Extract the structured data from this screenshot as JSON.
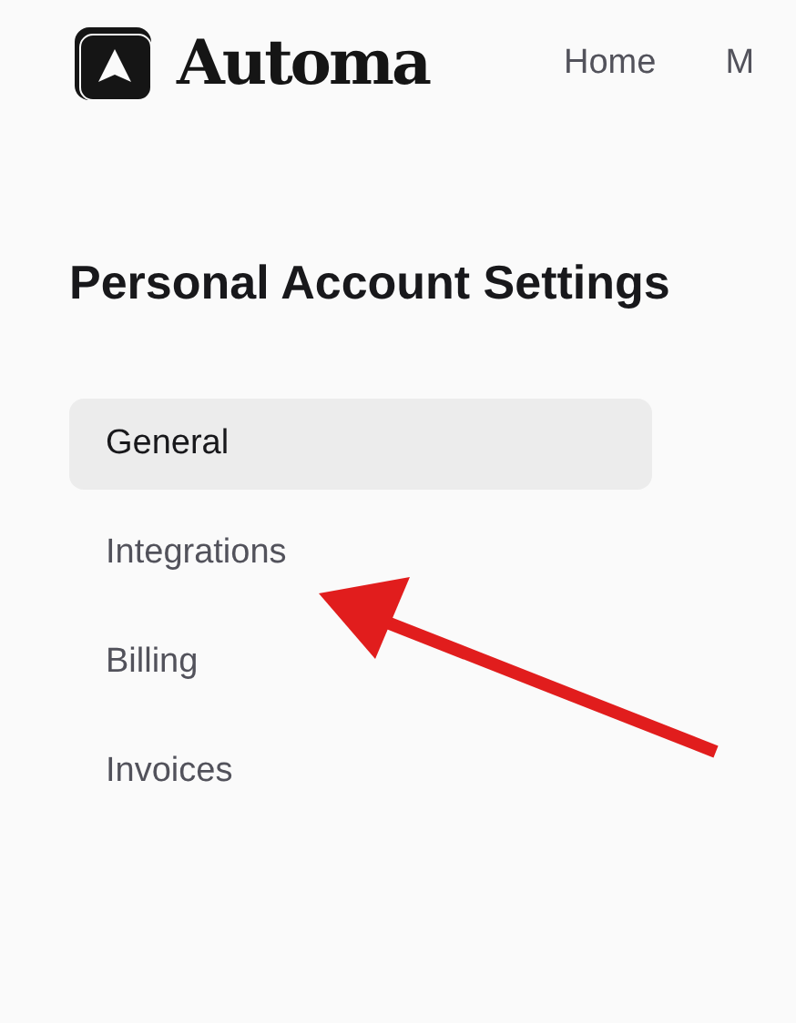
{
  "header": {
    "brand": "Automa",
    "nav": [
      "Home",
      "M"
    ]
  },
  "title": "Personal Account Settings",
  "sidebar": {
    "items": [
      {
        "label": "General",
        "selected": true
      },
      {
        "label": "Integrations",
        "selected": false
      },
      {
        "label": "Billing",
        "selected": false
      },
      {
        "label": "Invoices",
        "selected": false
      }
    ]
  }
}
